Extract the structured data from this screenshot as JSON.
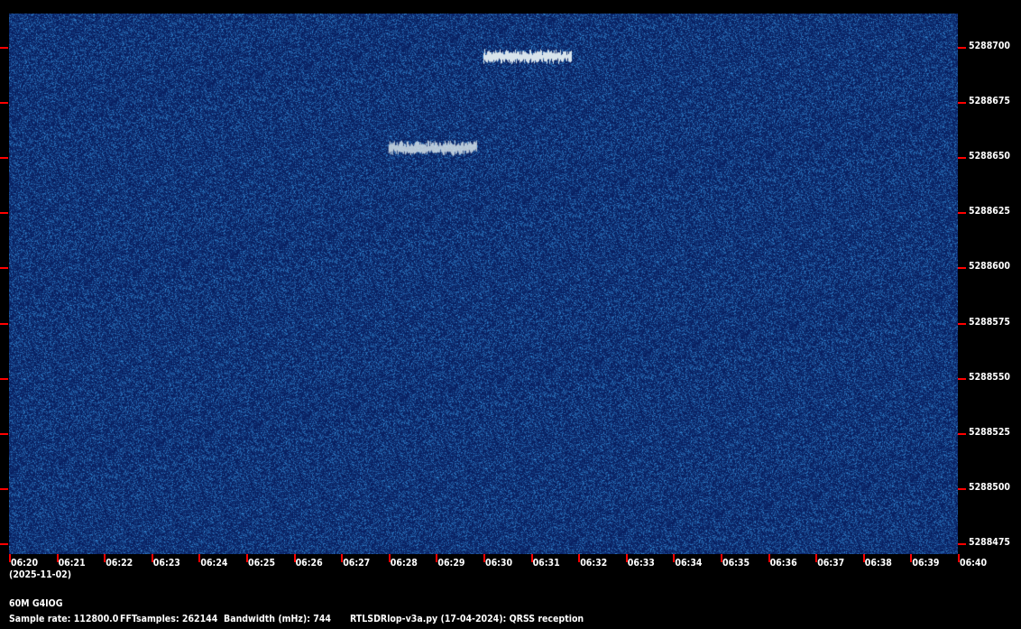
{
  "chart_data": {
    "type": "heatmap",
    "title": "60M G4IOG",
    "date": "(2025-11-02)",
    "x_ticks": [
      "06:20",
      "06:21",
      "06:22",
      "06:23",
      "06:24",
      "06:25",
      "06:26",
      "06:27",
      "06:28",
      "06:29",
      "06:30",
      "06:31",
      "06:32",
      "06:33",
      "06:34",
      "06:35",
      "06:36",
      "06:37",
      "06:38",
      "06:39",
      "06:40"
    ],
    "y_ticks": [
      "5288700",
      "5288675",
      "5288650",
      "5288625",
      "5288600",
      "5288575",
      "5288550",
      "5288525",
      "5288500",
      "5288475"
    ],
    "xlim_minutes": [
      0,
      20
    ],
    "ylim_hz": [
      5288470.5,
      5288715.5
    ],
    "signals": [
      {
        "start_min": 10.0,
        "end_min": 11.85,
        "freq_hz": 5288696
      },
      {
        "start_min": 8.0,
        "end_min": 9.85,
        "freq_hz": 5288654.5
      }
    ],
    "colors": {
      "background": "#0b2a66",
      "signal": "#d8e4ec",
      "tick": "#ff0000"
    }
  },
  "footer": {
    "station": "60M G4IOG",
    "sample_rate": "Sample rate: 112800.0",
    "fft_samples": "FFTsamples: 262144",
    "bandwidth": "Bandwidth (mHz): 744",
    "program": "RTLSDRlop-v3a.py (17-04-2024): QRSS reception"
  }
}
